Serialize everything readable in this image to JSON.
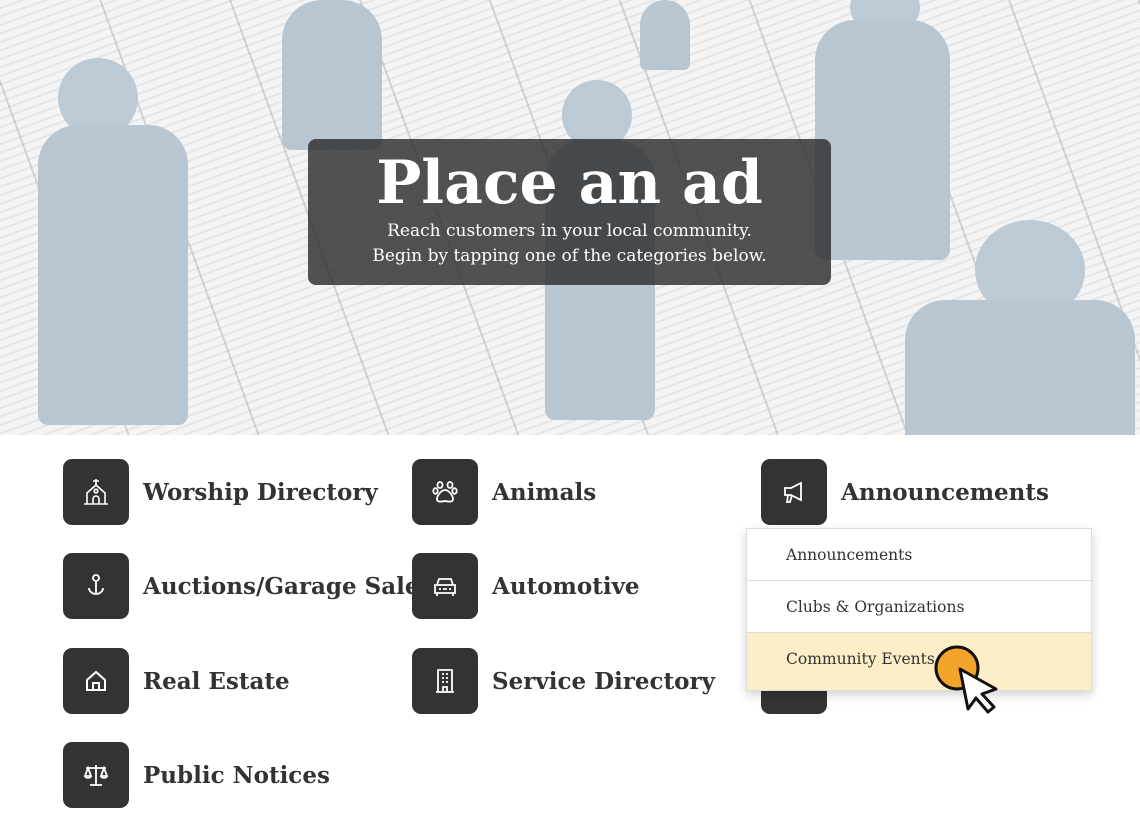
{
  "hero": {
    "title": "Place an ad",
    "subtitle_line1": "Reach customers in your local community.",
    "subtitle_line2": "Begin by tapping one of the categories below."
  },
  "categories": [
    {
      "label": "Worship Directory",
      "icon": "church-icon"
    },
    {
      "label": "Animals",
      "icon": "paw-icon"
    },
    {
      "label": "Announcements",
      "icon": "megaphone-icon"
    },
    {
      "label": "Auctions/Garage Sales",
      "icon": "gavel-anchor-icon"
    },
    {
      "label": "Automotive",
      "icon": "car-icon"
    },
    {
      "label": "Real Estate",
      "icon": "house-icon"
    },
    {
      "label": "Service Directory",
      "icon": "building-icon"
    },
    {
      "label": "Public Notices",
      "icon": "scales-icon"
    }
  ],
  "dropdown": {
    "items": [
      "Announcements",
      "Clubs & Organizations",
      "Community Events"
    ],
    "highlighted": "Community Events"
  },
  "colors": {
    "tile": "#333333",
    "highlight": "#fcefc8",
    "cursor_dot": "#f2a52a"
  }
}
